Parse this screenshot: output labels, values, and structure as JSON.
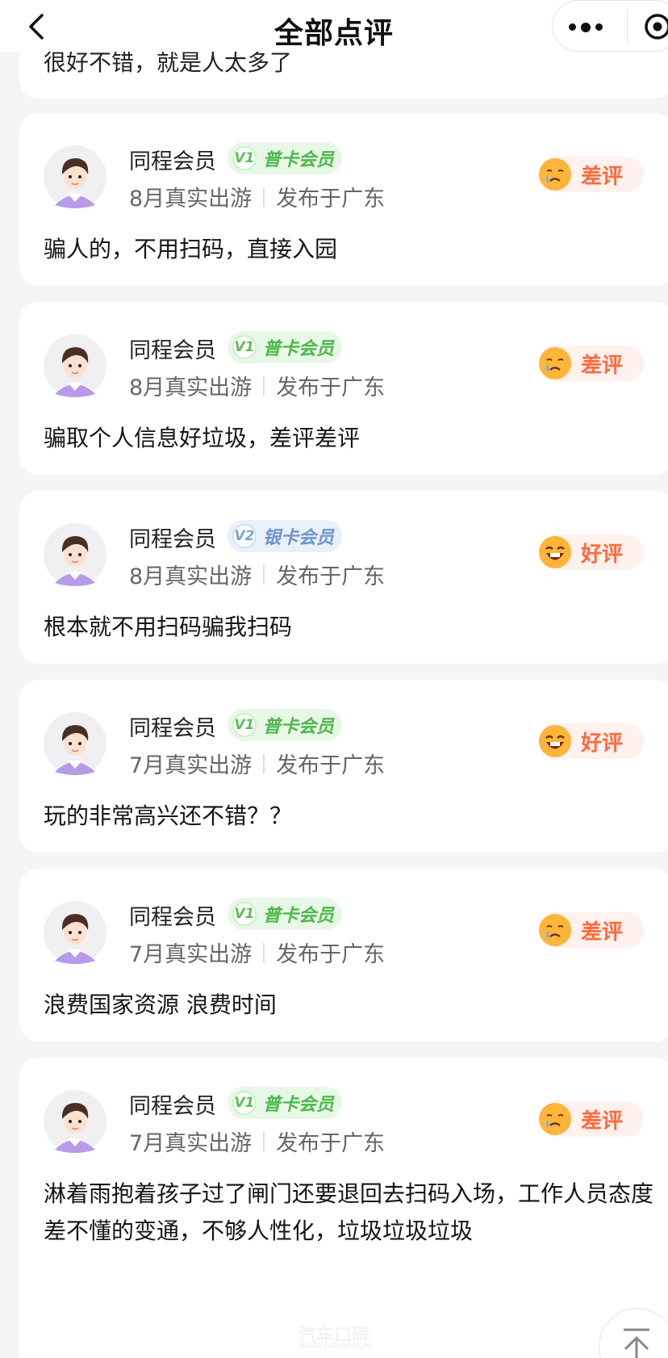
{
  "header": {
    "title": "全部点评"
  },
  "partial_review": {
    "text": "很好不错，就是人太多了"
  },
  "reviews": [
    {
      "name": "同程会员",
      "level": "V1",
      "level_name": "普卡会员",
      "tier": "green",
      "date": "8月真实出游",
      "location": "发布于广东",
      "rating": "差评",
      "rating_type": "bad",
      "content": "骗人的，不用扫码，直接入园"
    },
    {
      "name": "同程会员",
      "level": "V1",
      "level_name": "普卡会员",
      "tier": "green",
      "date": "8月真实出游",
      "location": "发布于广东",
      "rating": "差评",
      "rating_type": "bad",
      "content": "骗取个人信息好垃圾，差评差评"
    },
    {
      "name": "同程会员",
      "level": "V2",
      "level_name": "银卡会员",
      "tier": "blue",
      "date": "8月真实出游",
      "location": "发布于广东",
      "rating": "好评",
      "rating_type": "good",
      "content": "根本就不用扫码骗我扫码"
    },
    {
      "name": "同程会员",
      "level": "V1",
      "level_name": "普卡会员",
      "tier": "green",
      "date": "7月真实出游",
      "location": "发布于广东",
      "rating": "好评",
      "rating_type": "good",
      "content": "玩的非常高兴还不错？？"
    },
    {
      "name": "同程会员",
      "level": "V1",
      "level_name": "普卡会员",
      "tier": "green",
      "date": "7月真实出游",
      "location": "发布于广东",
      "rating": "差评",
      "rating_type": "bad",
      "content": "浪费国家资源 浪费时间"
    },
    {
      "name": "同程会员",
      "level": "V1",
      "level_name": "普卡会员",
      "tier": "green",
      "date": "7月真实出游",
      "location": "发布于广东",
      "rating": "差评",
      "rating_type": "bad",
      "content": "淋着雨抱着孩子过了闸门还要退回去扫码入场，工作人员态度差不懂的变通，不够人性化，垃圾垃圾垃圾"
    }
  ],
  "watermark": {
    "text": "汽车口碑",
    "url": "WWW.GDMM.COM"
  }
}
